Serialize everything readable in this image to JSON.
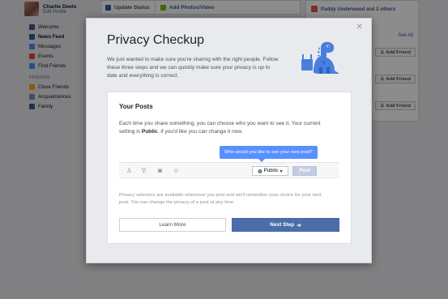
{
  "background": {
    "profile": {
      "name": "Charlie Deets",
      "edit": "Edit Profile"
    },
    "nav": [
      {
        "label": "Welcome",
        "color": "#3b5998"
      },
      {
        "label": "News Feed",
        "color": "#3b5998"
      },
      {
        "label": "Messages",
        "color": "#4c8df6"
      },
      {
        "label": "Events",
        "color": "#e04a3f"
      },
      {
        "label": "Find Friends",
        "color": "#4c8df6"
      }
    ],
    "friends_heading": "FRIENDS",
    "friends": [
      {
        "label": "Close Friends",
        "color": "#f5a623"
      },
      {
        "label": "Acquaintances",
        "color": "#7b8bb4"
      },
      {
        "label": "Family",
        "color": "#3b5998"
      }
    ],
    "composer": {
      "update_status": "Update Status",
      "add_photos": "Add Photos/Video"
    },
    "notification": {
      "name": "Paddy Underwood",
      "rest": "and",
      "others": "2 others"
    },
    "see_all": "See All",
    "add_friend": "Add Friend"
  },
  "modal": {
    "title": "Privacy Checkup",
    "intro": "We just wanted to make sure you're sharing with the right people. Follow these three steps and we can quickly make sure your privacy is up to date and everything is correct.",
    "card": {
      "title": "Your Posts",
      "text_before": "Each time you share something, you can choose who you want to see it. Your current setting is ",
      "setting": "Public",
      "text_after": ", if you'd like you can change it now.",
      "tooltip": "Who would you like to see your next post?",
      "privacy_button": "Public",
      "post_button": "Post",
      "note": "Privacy selectors are available whenever you post and we'll remember your choice for your next post. You can change the privacy of a post at any time.",
      "learn_more": "Learn More",
      "next_step": "Next Step"
    }
  },
  "colors": {
    "accent": "#4b6ea9",
    "tooltip": "#5890ff",
    "dino": "#4a7fe0"
  }
}
